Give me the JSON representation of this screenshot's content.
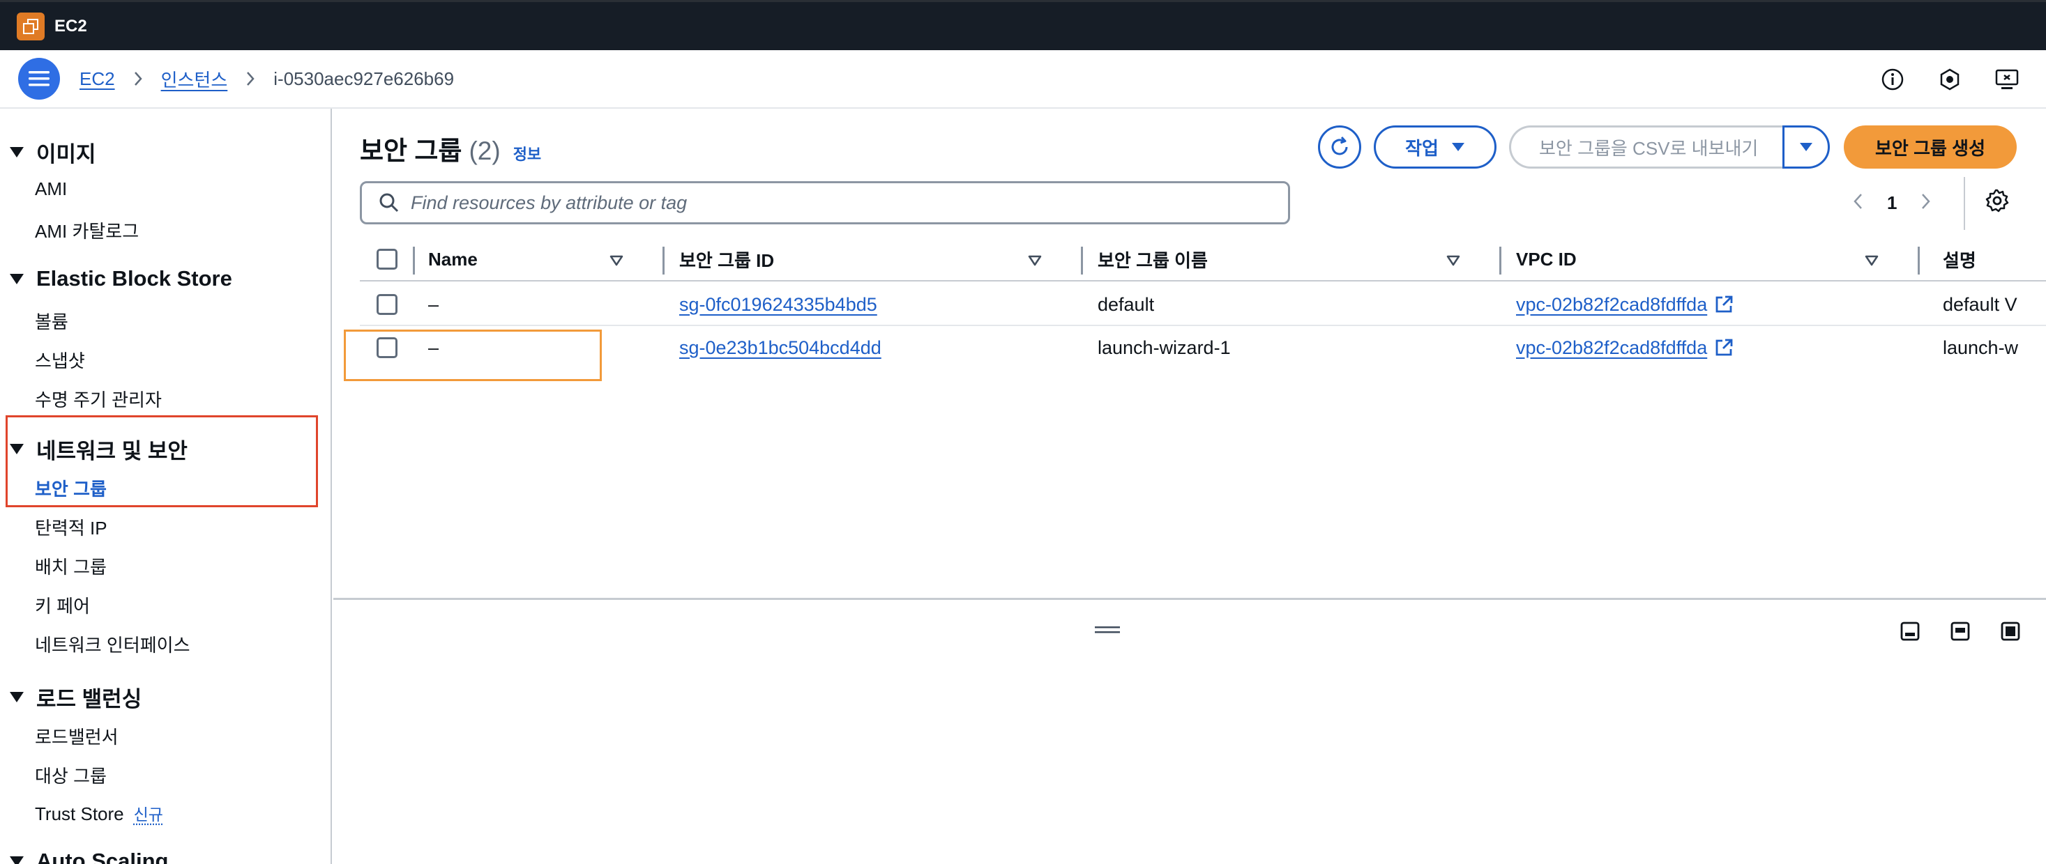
{
  "app": {
    "title": "EC2"
  },
  "breadcrumb": {
    "ec2": "EC2",
    "instances": "인스턴스",
    "current": "i-0530aec927e626b69"
  },
  "icons": {
    "menu": "hamburger-icon",
    "info": "info-circle-icon",
    "notifications": "notification-icon",
    "feedback": "screen-feedback-icon"
  },
  "sidebar": {
    "sections": [
      {
        "label": "이미지",
        "items": [
          {
            "label": "AMI"
          },
          {
            "label": "AMI 카탈로그"
          }
        ]
      },
      {
        "label": "Elastic Block Store",
        "items": [
          {
            "label": "볼륨"
          },
          {
            "label": "스냅샷"
          },
          {
            "label": "수명 주기 관리자"
          }
        ]
      },
      {
        "label": "네트워크 및 보안",
        "items": [
          {
            "label": "보안 그룹",
            "active": true
          },
          {
            "label": "탄력적 IP"
          },
          {
            "label": "배치 그룹"
          },
          {
            "label": "키 페어"
          },
          {
            "label": "네트워크 인터페이스"
          }
        ]
      },
      {
        "label": "로드 밸런싱",
        "items": [
          {
            "label": "로드밸런서"
          },
          {
            "label": "대상 그룹"
          },
          {
            "label": "Trust Store",
            "badge": "신규"
          }
        ]
      },
      {
        "label": "Auto Scaling",
        "items": []
      }
    ]
  },
  "panel": {
    "title": "보안 그룹",
    "count": "(2)",
    "info": "정보",
    "actions_label": "작업",
    "export_placeholder": "보안 그룹을 CSV로 내보내기",
    "create_label": "보안 그룹 생성",
    "search_placeholder": "Find resources by attribute or tag",
    "page": "1"
  },
  "table": {
    "headers": {
      "name": "Name",
      "sg_id": "보안 그룹 ID",
      "sg_name": "보안 그룹 이름",
      "vpc_id": "VPC ID",
      "desc": "설명"
    },
    "rows": [
      {
        "name": "–",
        "sg_id": "sg-0fc019624335b4bd5",
        "sg_name": "default",
        "vpc_id": "vpc-02b82f2cad8fdffda",
        "desc": "default V"
      },
      {
        "name": "–",
        "sg_id": "sg-0e23b1bc504bcd4dd",
        "sg_name": "launch-wizard-1",
        "vpc_id": "vpc-02b82f2cad8fdffda",
        "desc": "launch-w"
      }
    ]
  },
  "colors": {
    "accent": "#1e5fc8",
    "primary_button": "#f29a3a",
    "topbar": "#161d26",
    "highlight_red": "#e0452c"
  }
}
